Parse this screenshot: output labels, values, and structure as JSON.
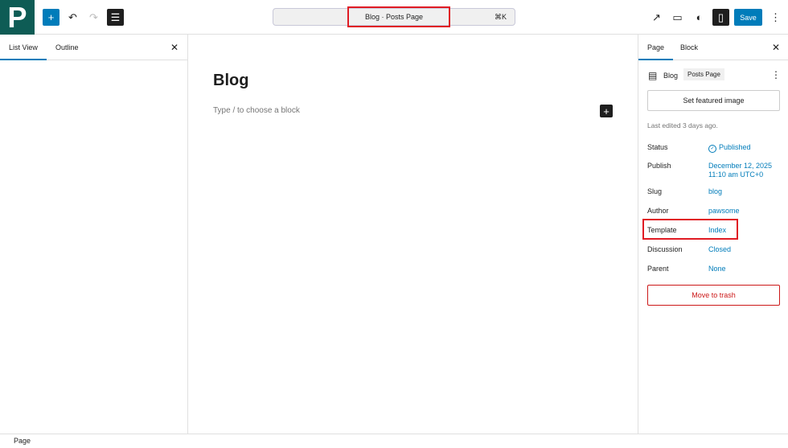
{
  "header": {
    "logo": "P",
    "add_icon": "+",
    "undo_icon": "↶",
    "redo_icon": "↷",
    "doc_overview_icon": "☰",
    "command": "Blog · Posts Page",
    "shortcut": "⌘K",
    "view_icon": "↗",
    "device_icon": "▭",
    "styles_icon": "◐",
    "settings_icon": "▯",
    "save": "Save",
    "options_icon": "⋮"
  },
  "left": {
    "tabs": [
      "List View",
      "Outline"
    ],
    "close": "✕"
  },
  "canvas": {
    "title": "Blog",
    "placeholder": "Type / to choose a block",
    "add": "+"
  },
  "sidebar": {
    "tabs": [
      "Page",
      "Block"
    ],
    "close": "✕",
    "page_icon": "▤",
    "page_title": "Blog",
    "page_badge": "Posts Page",
    "more": "⋮",
    "featured": "Set featured image",
    "last_edited": "Last edited 3 days ago.",
    "rows": [
      {
        "label": "Status",
        "value": "Published"
      },
      {
        "label": "Publish",
        "value": "December 12, 2025 11:10 am UTC+0"
      },
      {
        "label": "Slug",
        "value": "blog"
      },
      {
        "label": "Author",
        "value": "pawsome"
      },
      {
        "label": "Template",
        "value": "Index"
      },
      {
        "label": "Discussion",
        "value": "Closed"
      },
      {
        "label": "Parent",
        "value": "None"
      }
    ],
    "status_icon": "✓",
    "trash": "Move to trash"
  },
  "statusbar": {
    "text": "Page"
  },
  "colors": {
    "accent": "#007cba",
    "logo": "#0e5c55",
    "highlight": "#e01b24",
    "danger": "#cc1818"
  }
}
